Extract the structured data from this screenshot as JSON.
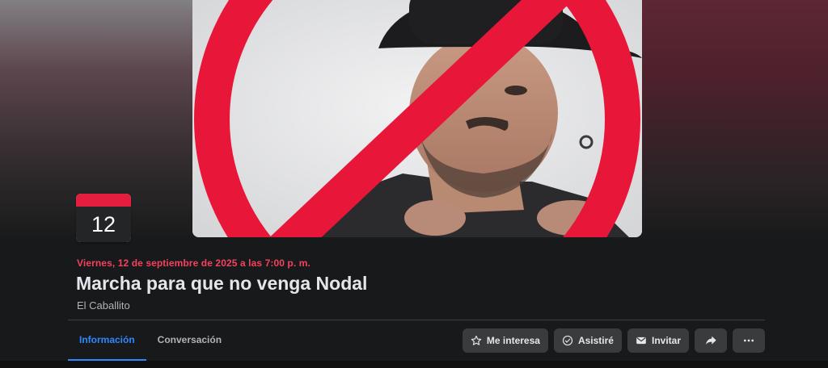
{
  "event": {
    "day_number": "12",
    "date_time": "Viernes, 12 de septiembre de 2025 a las 7:00 p. m.",
    "title": "Marcha para que no venga Nodal",
    "location": "El Caballito"
  },
  "tabs": [
    {
      "label": "Información",
      "active": true
    },
    {
      "label": "Conversación",
      "active": false
    }
  ],
  "actions": {
    "interested_label": "Me interesa",
    "going_label": "Asistiré",
    "invite_label": "Invitar",
    "share_icon": "share-arrow-icon",
    "more_icon": "more-dots-icon"
  },
  "colors": {
    "accent": "#2d88ff",
    "date_red": "#f3425f",
    "prohibition_red": "#e8173a",
    "button_bg": "#3a3b3c",
    "page_bg": "#18191a"
  }
}
